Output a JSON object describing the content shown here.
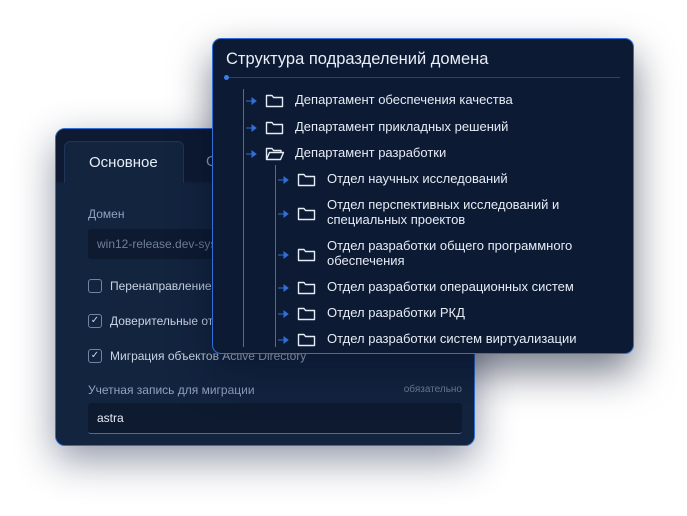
{
  "back_window": {
    "tabs": [
      "Основное",
      "О"
    ],
    "domain_label": "Домен",
    "domain_value": "win12-release.dev-sys",
    "checkboxes": [
      {
        "label": "Перенаправление",
        "checked": false
      },
      {
        "label": "Доверительные от",
        "checked": true
      },
      {
        "label": "Миграция объектов Active Directory",
        "checked": true
      }
    ],
    "account_label": "Учетная запись для миграции",
    "account_required": "обязательно",
    "account_value": "astra"
  },
  "front_window": {
    "title": "Структура подразделений домена",
    "tree": [
      {
        "label": "Департамент обеспечения качества",
        "open": false,
        "level": 0
      },
      {
        "label": "Департамент прикладных решений",
        "open": false,
        "level": 0
      },
      {
        "label": "Департамент разработки",
        "open": true,
        "level": 0
      },
      {
        "label": "Отдел научных исследований",
        "open": false,
        "level": 1
      },
      {
        "label": "Отдел перспективных исследований и\nспециальных проектов",
        "open": false,
        "level": 1
      },
      {
        "label": "Отдел разработки общего программного\nобеспечения",
        "open": false,
        "level": 1
      },
      {
        "label": "Отдел разработки операционных систем",
        "open": false,
        "level": 1
      },
      {
        "label": "Отдел разработки РКД",
        "open": false,
        "level": 1
      },
      {
        "label": "Отдел разработки систем виртуализации",
        "open": false,
        "level": 1
      }
    ]
  },
  "colors": {
    "accent": "#2f6fd6",
    "panel": "#0c1a33",
    "text": "#e6ecf6"
  },
  "icons": [
    "folder-icon",
    "folder-open-icon",
    "arrow-right-icon",
    "checkbox-icon"
  ]
}
